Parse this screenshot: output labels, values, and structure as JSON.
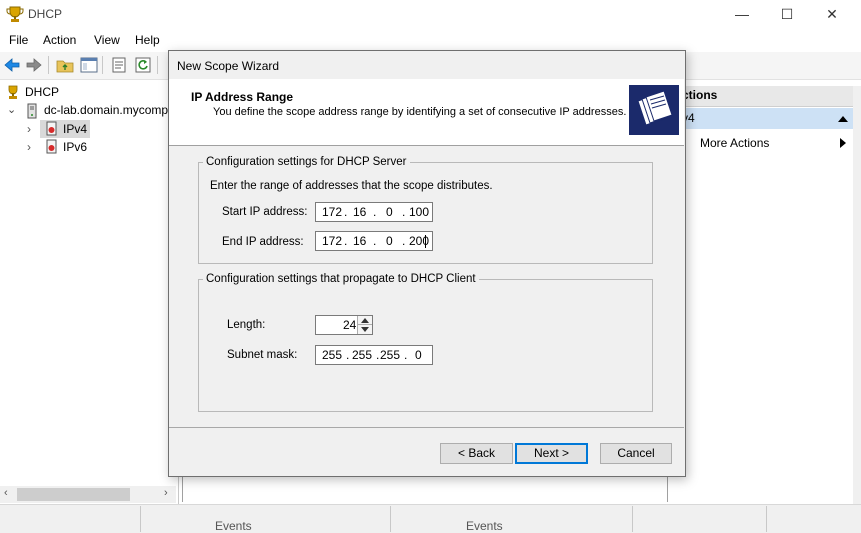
{
  "window": {
    "title": "DHCP",
    "icon": "trophy-icon",
    "caption": {
      "minimize": "—",
      "maximize": "☐",
      "close": "✕"
    }
  },
  "menu": [
    "File",
    "Action",
    "View",
    "Help"
  ],
  "toolbar": {
    "icons": [
      "back-arrow-icon",
      "forward-arrow-icon",
      "up-folder-icon",
      "show-hide-tree-icon",
      "properties-icon",
      "refresh-icon"
    ]
  },
  "tree": {
    "root": "DHCP",
    "server": "dc-lab.domain.mycomp",
    "children": [
      "IPv4",
      "IPv6"
    ]
  },
  "actions": {
    "title": "Actions",
    "title_visible": "ctions",
    "selected": "v4",
    "items": [
      "More Actions"
    ]
  },
  "statusbar": {
    "cells": [
      "Events",
      "Events"
    ]
  },
  "wizard": {
    "title": "New Scope Wizard",
    "heading": "IP Address Range",
    "subheading": "You define the scope address range by identifying a set of consecutive IP addresses.",
    "server_group": {
      "label": "Configuration settings for DHCP Server",
      "instruction": "Enter the range of addresses that the scope distributes.",
      "start_label": "Start IP address:",
      "start_ip": [
        "172",
        "16",
        "0",
        "100"
      ],
      "end_label": "End IP address:",
      "end_ip": [
        "172",
        "16",
        "0",
        "200"
      ]
    },
    "client_group": {
      "label": "Configuration settings that propagate to DHCP Client",
      "length_label": "Length:",
      "length_value": "24",
      "mask_label": "Subnet mask:",
      "mask": [
        "255",
        "255",
        "255",
        "0"
      ]
    },
    "buttons": {
      "back": "< Back",
      "next": "Next >",
      "cancel": "Cancel"
    }
  },
  "colors": {
    "selection": "#cde1f5",
    "accent": "#0078d7",
    "dialog_bg": "#f0f0f0"
  }
}
